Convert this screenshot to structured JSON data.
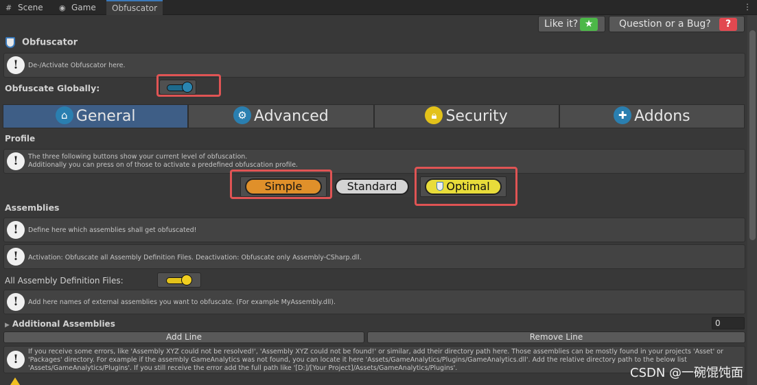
{
  "tabs": [
    {
      "label": "Scene",
      "icon": "grid-icon"
    },
    {
      "label": "Game",
      "icon": "gamepad-icon"
    },
    {
      "label": "Obfuscator",
      "icon": ""
    }
  ],
  "tab_menu": "⋮",
  "buttons": {
    "like": "Like it?",
    "question": "Question or a Bug?",
    "like_badge": "★",
    "question_badge": "?"
  },
  "header": {
    "title": "Obfuscator",
    "icon": "shield-icon"
  },
  "help": {
    "activate": "De-/Activate Obfuscator here.",
    "profile_line1": "The three following buttons show your current level of obfuscation.",
    "profile_line2": "Additionally you can press on of those to activate a predefined obfuscation profile.",
    "assemblies": "Define here which assemblies shall get obfuscated!",
    "activation": "Activation: Obfuscate all Assembly Definition Files. Deactivation: Obfuscate only Assembly-CSharp.dll.",
    "external": "Add here names of external assemblies you want to obfuscate. (For example MyAssembly.dll).",
    "errors_line1": "If you receive some errors, like 'Assembly XYZ could not be resolved!', 'Assembly XYZ could not be found!' or similar, add their directory path here. Those assemblies can be mostly found in your projects 'Asset' or",
    "errors_line2": "'Packages' directory. For example if the assembly GameAnalytics was not found, you can locate it here 'Assets/GameAnalytics/Plugins/GameAnalytics.dll'. Add the relative directory path to the below list",
    "errors_line3": "'Assets/GameAnalytics/Plugins'. If you still receive the error add the full path like '[D:]/[Your Project]/Assets/GameAnalytics/Plugins'."
  },
  "labels": {
    "obfuscate_globally": "Obfuscate Globally:",
    "profile": "Profile",
    "assemblies": "Assemblies",
    "all_assembly_files": "All Assembly Definition Files:",
    "additional_assemblies": "Additional Assemblies"
  },
  "toggles": {
    "obfuscate_globally": true,
    "all_assembly_files": true
  },
  "section_tabs": [
    {
      "label": "General",
      "icon": "home-icon",
      "color": "#2a7fb0"
    },
    {
      "label": "Advanced",
      "icon": "gears-icon",
      "color": "#2a7fb0"
    },
    {
      "label": "Security",
      "icon": "lock-icon",
      "color": "#e3c21a"
    },
    {
      "label": "Addons",
      "icon": "puzzle-icon",
      "color": "#2a7fb0"
    }
  ],
  "profiles": {
    "simple": "Simple",
    "standard": "Standard",
    "optimal": "Optimal"
  },
  "additional_assemblies_count": "0",
  "list_buttons": {
    "add": "Add Line",
    "remove": "Remove Line"
  },
  "watermark": "CSDN @一碗馄饨面",
  "colors": {
    "accent_blue": "#3e5e86",
    "highlight_red": "#e05454",
    "simple_orange": "#e0902a",
    "optimal_yellow": "#e8dc3a"
  }
}
